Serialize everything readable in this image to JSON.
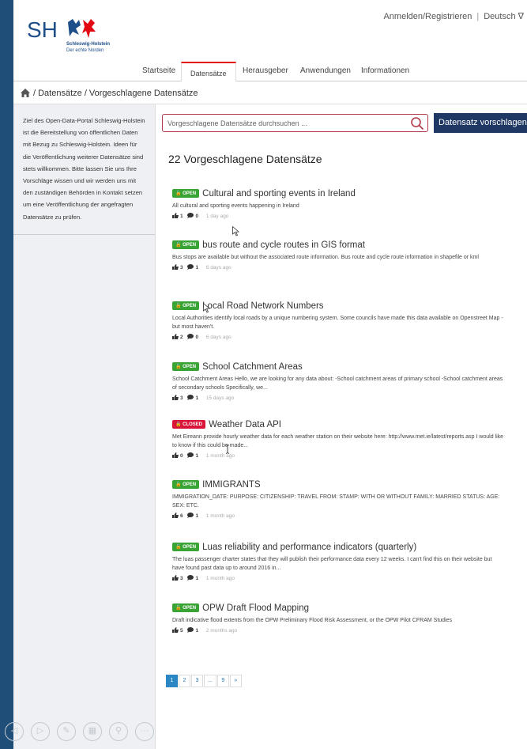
{
  "logo": {
    "text": "SH",
    "line1": "Schleswig-Holstein",
    "line2": "Der echte Norden"
  },
  "toplinks": {
    "login": "Anmelden/Registrieren",
    "language": "Deutsch",
    "language_caret": "∇"
  },
  "nav": [
    {
      "label": "Startseite"
    },
    {
      "label": "Datensätze"
    },
    {
      "label": "Herausgeber"
    },
    {
      "label": "Anwendungen"
    },
    {
      "label": "Informationen"
    }
  ],
  "breadcrumb": "/ Datensätze / Vorgeschlagene Datensätze",
  "sidebar": {
    "text": "Ziel des Open-Data-Portal Schleswig-Holstein ist die Bereitstellung von öffentlichen Daten mit Bezug zu Schleswig-Holstein. Ideen für die Veröffentlichung weiterer Datensätze sind stets willkommen. Bitte lassen Sie uns Ihre Vorschläge wissen und wir werden uns mit den zuständigen Behörden in Kontakt setzen um eine Veröffentlichung der angefragten Datensätze zu prüfen."
  },
  "search": {
    "placeholder": "Vorgeschlagene Datensätze durchsuchen ..."
  },
  "propose_button": "Datensatz vorschlagen",
  "list_title": "22 Vorgeschlagene Datensätze",
  "entries": [
    {
      "status": "OPEN",
      "title": "Cultural and sporting events in Ireland",
      "desc": "All cultural and sporting events happening in Ireland",
      "likes": "1",
      "comments": "0",
      "ago": "1 day ago"
    },
    {
      "status": "OPEN",
      "title": "bus route and cycle routes in GIS format",
      "desc": "Bus stops are available but without the associated route information. Bus route and cycle route information in shapefile or kml",
      "likes": "3",
      "comments": "1",
      "ago": "6 days ago"
    },
    {
      "status": "OPEN",
      "title": "Local Road Network Numbers",
      "desc": "Local Authorities identify local roads by a unique numbering system. Some councils have made this data available on Openstreet Map - but most haven't.",
      "likes": "2",
      "comments": "0",
      "ago": "6 days ago"
    },
    {
      "status": "OPEN",
      "title": "School Catchment Areas",
      "desc": "School Catchment Areas Hello, we are looking for any data about: -School catchment areas of primary school -School catchment areas of secondary schools Specifically, we...",
      "likes": "3",
      "comments": "1",
      "ago": "15 days ago"
    },
    {
      "status": "CLOSED",
      "title": "Weather Data API",
      "desc": "Met Eireann provide hourly weather data for each weather station on their website here: http://www.met.ie/latest/reports.asp I would like to know if this could be made...",
      "likes": "0",
      "comments": "1",
      "ago": "1 month ago"
    },
    {
      "status": "OPEN",
      "title": "IMMIGRANTS",
      "desc": "IMMIGRATION_DATE: PURPOSE: CITIZENSHIP: TRAVEL FROM: STAMP: WITH OR WITHOUT FAMILY: MARRIED STATUS: AGE: SEX: ETC.",
      "likes": "6",
      "comments": "1",
      "ago": "1 month ago"
    },
    {
      "status": "OPEN",
      "title": "Luas reliability and performance indicators (quarterly)",
      "desc": "The luas passenger charter states that they will publish their performance data every 12 weeks. I can't find this on their website but have found past data up to around 2016 in...",
      "likes": "3",
      "comments": "1",
      "ago": "1 month ago"
    },
    {
      "status": "OPEN",
      "title": "OPW Draft Flood Mapping",
      "desc": "Draft indicative flood extents from the OPW Preliminary Flood Risk Assessment, or the OPW Pilot CFRAM Studies",
      "likes": "5",
      "comments": "1",
      "ago": "2 months ago"
    }
  ],
  "pagination": [
    "1",
    "2",
    "3",
    "...",
    "9",
    "»"
  ],
  "colors": {
    "brand": "#1d4e89",
    "accent_red": "#e30613",
    "open": "#3aa335",
    "closed": "#d9163a",
    "button": "#1f3864"
  }
}
